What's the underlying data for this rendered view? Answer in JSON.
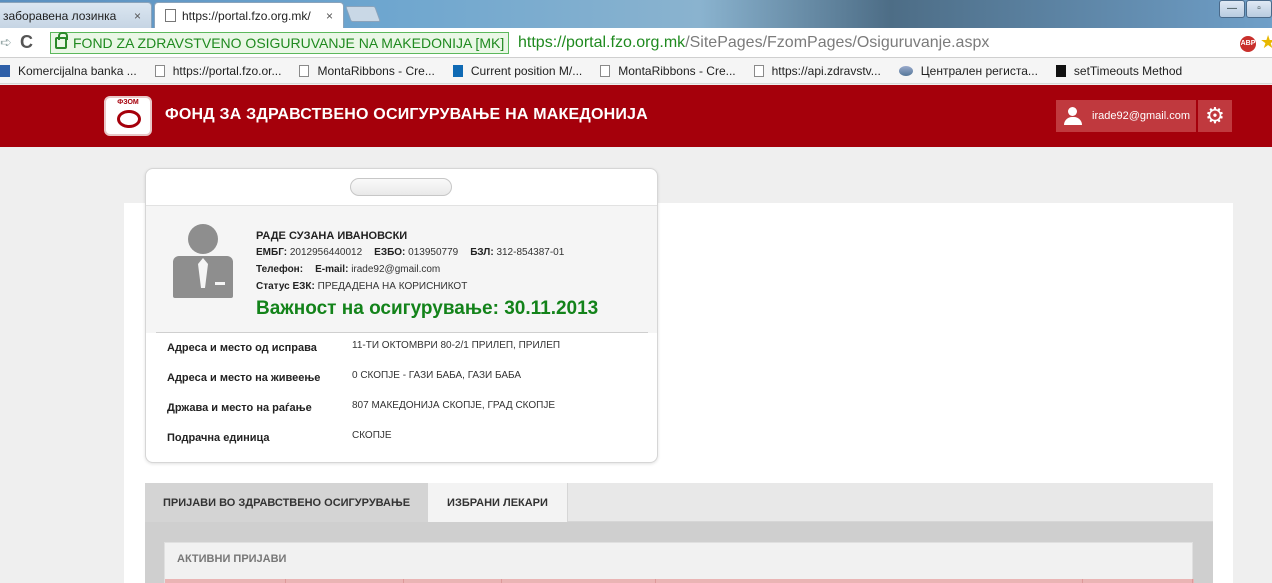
{
  "browser": {
    "tabs": [
      {
        "label": "заборавена лозинка",
        "close": "×"
      },
      {
        "label": "https://portal.fzo.org.mk/",
        "close": "×"
      }
    ],
    "window_controls": [
      "—",
      "▫",
      "✕"
    ],
    "ev_label": "FOND ZA ZDRAVSTVENO OSIGURUVANJE NA MAKEDONIJA [MK]",
    "url_host": "https://portal.fzo.org.mk",
    "url_path": "/SitePages/FzomPages/Osiguruvanje.aspx",
    "abp_label": "ABP",
    "bookmarks": [
      {
        "label": "Komercijalna banka ...",
        "icon": "bank-icon"
      },
      {
        "label": "https://portal.fzo.or...",
        "icon": "page-icon"
      },
      {
        "label": "MontaRibbons - Cre...",
        "icon": "page-icon"
      },
      {
        "label": "Current position M/...",
        "icon": "info-icon"
      },
      {
        "label": "MontaRibbons - Cre...",
        "icon": "page-icon"
      },
      {
        "label": "https://api.zdravstv...",
        "icon": "page-icon"
      },
      {
        "label": "Централен региста...",
        "icon": "registry-icon"
      },
      {
        "label": "setTimeouts Method",
        "icon": "m-icon"
      }
    ]
  },
  "site": {
    "logo_text": "ФЗОМ",
    "title": "ФОНД ЗА ЗДРАВСТВЕНО ОСИГУРУВАЊЕ НА МАКЕДОНИЈА",
    "user_email": "irade92@gmail.com",
    "brand_color": "#a5000b"
  },
  "profile": {
    "name": "РАДЕ СУЗАНА  ИВАНОВСКИ",
    "embg_label": "ЕМБГ:",
    "embg": "2012956440012",
    "ezbo_label": "ЕЗБО:",
    "ezbo": "013950779",
    "bzl_label": "БЗЛ:",
    "bzl": "312-854387-01",
    "phone_label": "Телефон:",
    "email_label": "E-mail:",
    "email": "irade92@gmail.com",
    "status_label": "Статус ЕЗК:",
    "status": "ПРЕДАДЕНА НА КОРИСНИКОТ",
    "validity": "Важност на осигурување: 30.11.2013",
    "validity_color": "#13831a"
  },
  "details": [
    {
      "label": "Адреса и место од исправа",
      "value": "11-ТИ ОКТОМВРИ 80-2/1 ПРИЛЕП, ПРИЛЕП"
    },
    {
      "label": "Адреса и место на живеење",
      "value": "0 СКОПЈЕ - ГАЗИ БАБА, ГАЗИ БАБА"
    },
    {
      "label": "Држава и место на раѓање",
      "value": "807 МАКЕДОНИЈА СКОПЈЕ, ГРАД СКОПЈЕ"
    },
    {
      "label": "Подрачна единица",
      "value": "СКОПЈЕ"
    }
  ],
  "content_tabs": [
    {
      "label": "ПРИЈАВИ ВО ЗДРАВСТВЕНО ОСИГУРУВАЊЕ",
      "active": true
    },
    {
      "label": "ИЗБРАНИ ЛЕКАРИ",
      "active": false
    }
  ],
  "active_section": {
    "title": "АКТИВНИ ПРИЈАВИ"
  }
}
